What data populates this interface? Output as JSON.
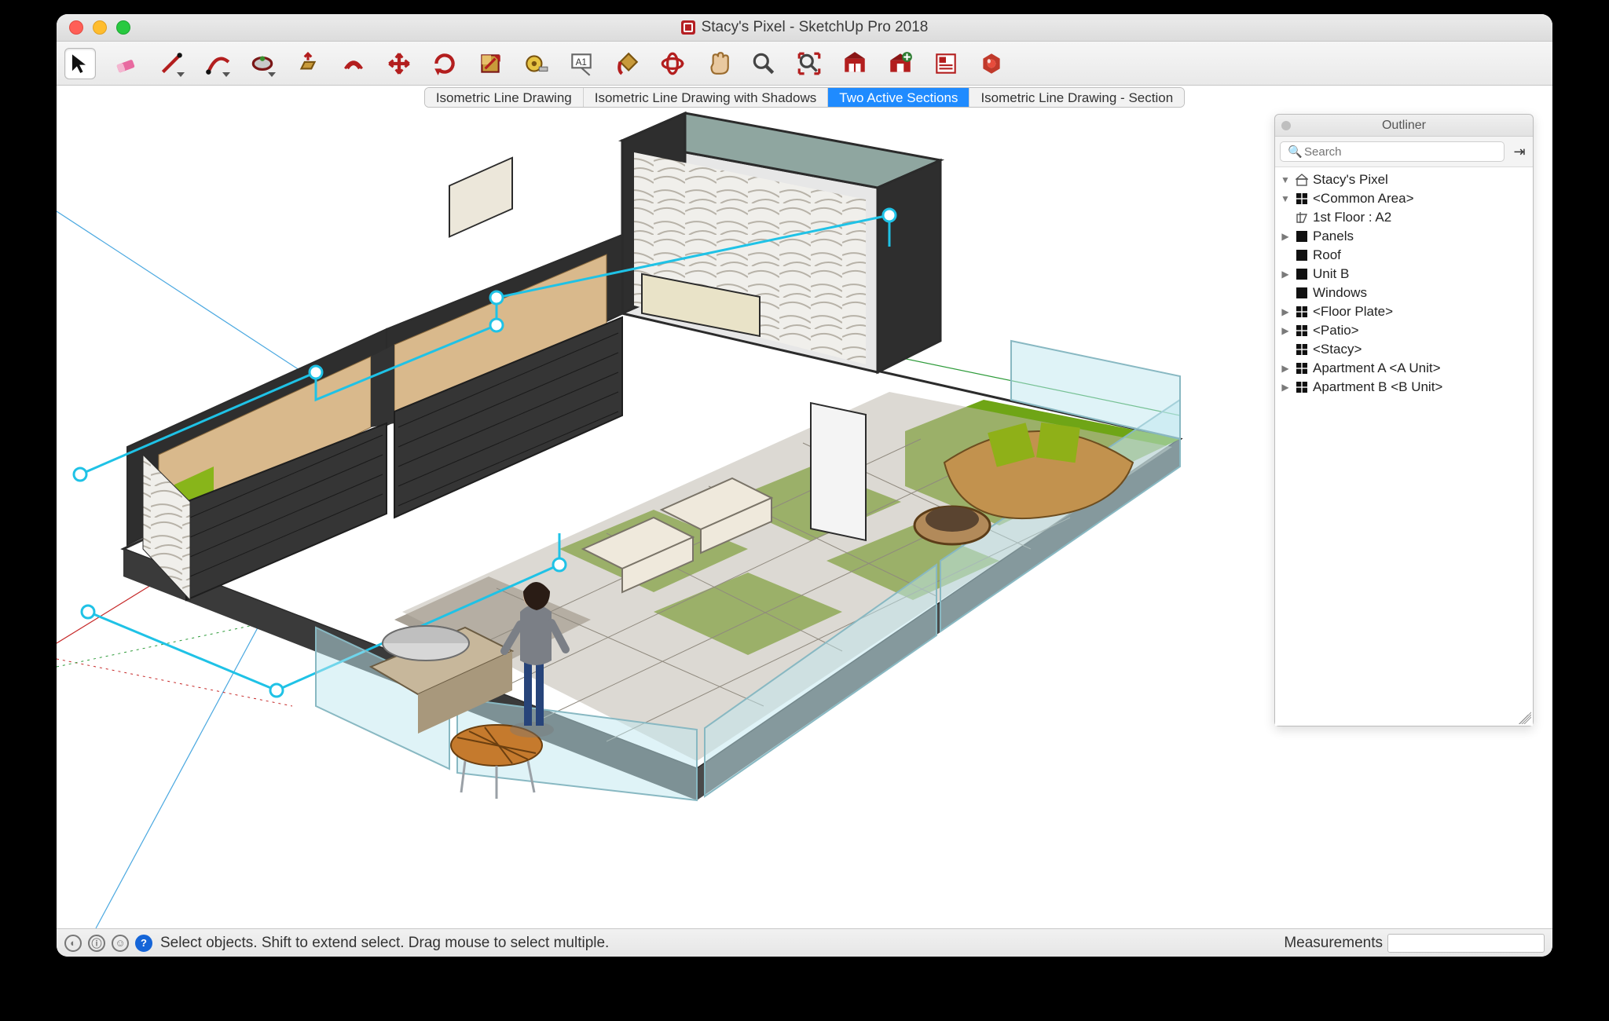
{
  "window": {
    "title": "Stacy's Pixel - SketchUp Pro 2018"
  },
  "toolbar": [
    {
      "name": "select-tool",
      "dd": false,
      "selected": true
    },
    {
      "name": "eraser-tool",
      "dd": false
    },
    {
      "name": "line-tool",
      "dd": true
    },
    {
      "name": "arc-tool",
      "dd": true
    },
    {
      "name": "shape-tool",
      "dd": true
    },
    {
      "name": "pushpull-tool",
      "dd": false
    },
    {
      "name": "offset-tool",
      "dd": false
    },
    {
      "name": "move-tool",
      "dd": false
    },
    {
      "name": "rotate-tool",
      "dd": false
    },
    {
      "name": "scale-tool",
      "dd": false
    },
    {
      "name": "tape-measure-tool",
      "dd": false
    },
    {
      "name": "text-tool",
      "dd": false
    },
    {
      "name": "paint-bucket-tool",
      "dd": false
    },
    {
      "name": "orbit-tool",
      "dd": false
    },
    {
      "name": "pan-tool",
      "dd": false
    },
    {
      "name": "zoom-tool",
      "dd": false
    },
    {
      "name": "zoom-extents-tool",
      "dd": false
    },
    {
      "name": "warehouse-tool",
      "dd": false
    },
    {
      "name": "warehouse-upload-tool",
      "dd": false
    },
    {
      "name": "layout-tool",
      "dd": false
    },
    {
      "name": "extensions-tool",
      "dd": false
    }
  ],
  "scenes": [
    {
      "label": "Isometric Line Drawing",
      "active": false
    },
    {
      "label": "Isometric Line Drawing with Shadows",
      "active": false
    },
    {
      "label": "Two Active Sections",
      "active": true
    },
    {
      "label": "Isometric Line Drawing - Section",
      "active": false
    }
  ],
  "outliner": {
    "title": "Outliner",
    "search_placeholder": "Search",
    "tree": [
      {
        "depth": 1,
        "tw": "▼",
        "icon": "house",
        "label": "Stacy's Pixel"
      },
      {
        "depth": 2,
        "tw": "▼",
        "icon": "grid",
        "label": "<Common Area>"
      },
      {
        "depth": 3,
        "tw": "",
        "icon": "sect",
        "label": "1st Floor : A2"
      },
      {
        "depth": 3,
        "tw": "▶",
        "icon": "solid",
        "label": "Panels"
      },
      {
        "depth": 3,
        "tw": "",
        "icon": "solid",
        "label": "Roof"
      },
      {
        "depth": 3,
        "tw": "▶",
        "icon": "solid",
        "label": "Unit B"
      },
      {
        "depth": 3,
        "tw": "",
        "icon": "solid",
        "label": "Windows"
      },
      {
        "depth": 2,
        "tw": "▶",
        "icon": "grid",
        "label": "<Floor Plate>"
      },
      {
        "depth": 2,
        "tw": "▶",
        "icon": "grid",
        "label": "<Patio>"
      },
      {
        "depth": 2,
        "tw": "",
        "icon": "grid",
        "label": "<Stacy>"
      },
      {
        "depth": 2,
        "tw": "▶",
        "icon": "grid",
        "label": "Apartment A <A Unit>"
      },
      {
        "depth": 2,
        "tw": "▶",
        "icon": "grid",
        "label": "Apartment B <B Unit>"
      }
    ]
  },
  "status": {
    "hint": "Select objects. Shift to extend select. Drag mouse to select multiple.",
    "measurements_label": "Measurements",
    "measurements_value": ""
  }
}
